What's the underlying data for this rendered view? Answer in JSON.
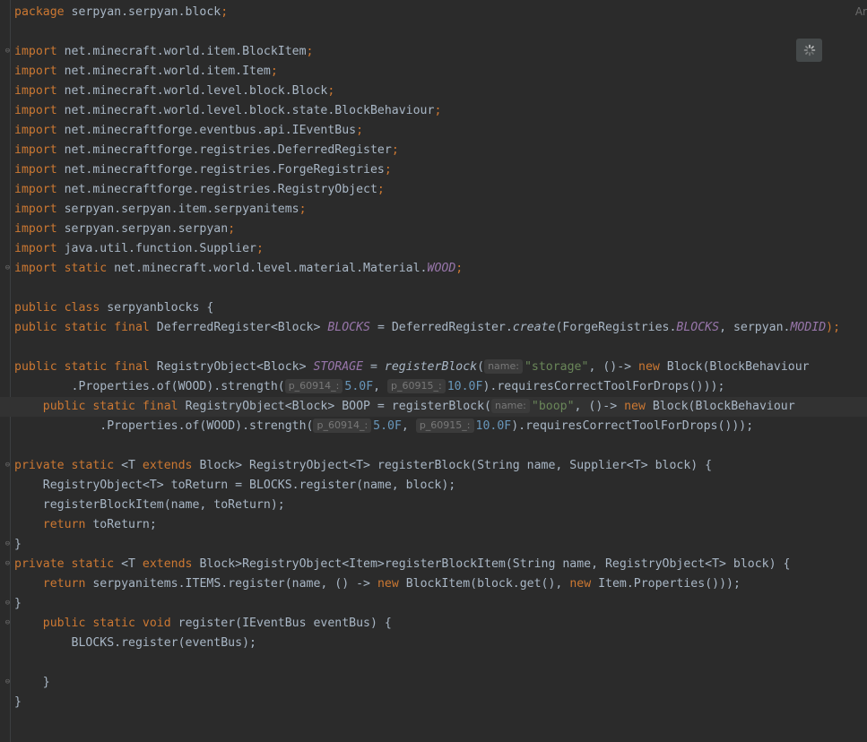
{
  "corner_label": "Ar",
  "spinner_icon": "loading-spinner-icon",
  "colors": {
    "background": "#2b2b2b",
    "keyword": "#cc7832",
    "string": "#6a8759",
    "number": "#6897bb",
    "static_field": "#9876aa",
    "plain": "#a9b7c6"
  },
  "code": {
    "pkg_kw": "package",
    "pkg_name": " serpyan.serpyan.block",
    "imports": [
      {
        "kw": "import",
        "path": " net.minecraft.world.item.BlockItem"
      },
      {
        "kw": "import",
        "path": " net.minecraft.world.item.Item"
      },
      {
        "kw": "import",
        "path": " net.minecraft.world.level.block.Block"
      },
      {
        "kw": "import",
        "path": " net.minecraft.world.level.block.state.BlockBehaviour"
      },
      {
        "kw": "import",
        "path": " net.minecraftforge.eventbus.api.IEventBus"
      },
      {
        "kw": "import",
        "path": " net.minecraftforge.registries.DeferredRegister"
      },
      {
        "kw": "import",
        "path": " net.minecraftforge.registries.ForgeRegistries"
      },
      {
        "kw": "import",
        "path": " net.minecraftforge.registries.RegistryObject"
      },
      {
        "kw": "import",
        "path": " serpyan.serpyan.item.serpyanitems"
      },
      {
        "kw": "import",
        "path": " serpyan.serpyan.serpyan"
      },
      {
        "kw": "import",
        "path": " java.util.function.Supplier"
      }
    ],
    "static_import_kw": "import static",
    "static_import_path": " net.minecraft.world.level.material.Material.",
    "static_import_const": "WOOD",
    "class_kw": "public class",
    "class_name": " serpyanblocks {",
    "blocks_kw": "public static final",
    "blocks_type": " DeferredRegister<Block> ",
    "blocks_name": "BLOCKS",
    "blocks_eq": " = DeferredRegister.",
    "blocks_create": "create",
    "blocks_args1": "(ForgeRegistries.",
    "blocks_args_const": "BLOCKS",
    "blocks_args2": ", serpyan.",
    "blocks_modid": "MODID",
    "blocks_end": ");",
    "storage_kw": "public static final",
    "storage_type": " RegistryObject<Block> ",
    "storage_name": "STORAGE",
    "storage_eq": " = ",
    "storage_call": "registerBlock",
    "storage_paren": "(",
    "hint_name": "name:",
    "storage_str": "\"storage\"",
    "storage_mid": ", ()-> ",
    "new_kw": "new",
    "storage_tail": " Block(BlockBehaviour",
    "storage_l2_a": "        .Properties.of(WOOD).strength(",
    "hint_p1": "p_60914_:",
    "num_5": "5.0F",
    "comma": ", ",
    "hint_p2": "p_60915_:",
    "num_10": "10.0F",
    "storage_l2_end": ").requiresCorrectToolForDrops()));",
    "boop_kw": "public static final",
    "boop_type": " RegistryObject<Block> BOOP = registerBlock(",
    "boop_str": "\"boop\"",
    "boop_mid": ", ()-> ",
    "boop_tail": " Block(BlockBehaviour",
    "boop_l2_a": "        .Properties.of(WOOD).strength(",
    "boop_l2_end": ").requiresCorrectToolForDrops()));",
    "rb_kw": "private static",
    "rb_sig1": " <T ",
    "rb_extends": "extends",
    "rb_sig2": " Block> RegistryObject<T> registerBlock(String name, Supplier<T> block) {",
    "rb_body1": "    RegistryObject<T> toReturn = BLOCKS.register(name, block);",
    "rb_body2": "    registerBlockItem(name, toReturn);",
    "return_kw": "return",
    "rb_body3": " toReturn;",
    "close_brace": "}",
    "rbi_kw": "private static",
    "rbi_sig1": " <T ",
    "rbi_extends": "extends",
    "rbi_sig2": " Block>RegistryObject<Item>registerBlockItem(String name, RegistryObject<T> block) {",
    "rbi_body_a": " serpyanitems.ITEMS.register(name, () -> ",
    "rbi_body_b": " BlockItem(block.get(), ",
    "rbi_body_c": " Item.Properties()));",
    "reg_kw": "public static void",
    "reg_sig": " register(IEventBus eventBus) {",
    "reg_body": "        BLOCKS.register(eventBus);",
    "inner_close": "    }",
    "outer_close": "}"
  }
}
